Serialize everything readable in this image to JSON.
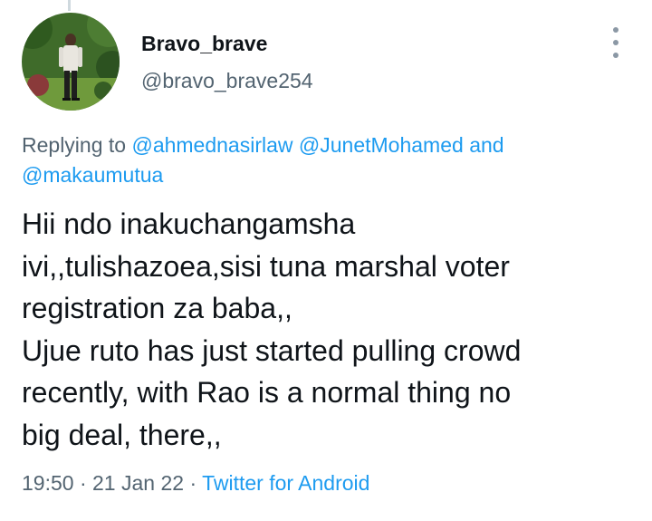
{
  "author": {
    "display_name": "Bravo_brave",
    "handle": "@bravo_brave254"
  },
  "reply": {
    "prefix": "Replying to",
    "mention_1": "@ahmednasirlaw",
    "mention_2": "@JunetMohamed",
    "conjunction": "and",
    "mention_3": "@makaumutua"
  },
  "tweet": {
    "lines": [
      "Hii ndo inakuchangamsha",
      "ivi,,tulishazoea,sisi tuna marshal voter",
      "registration za baba,,",
      "Ujue ruto has just started pulling crowd",
      "recently, with Rao is a normal thing no",
      "big deal, there,,"
    ]
  },
  "meta": {
    "time": "19:50",
    "separator": "·",
    "date": "21 Jan 22",
    "source": "Twitter for Android"
  },
  "icons": {
    "more": "more-vertical-icon"
  },
  "colors": {
    "text_primary": "#0f1419",
    "text_secondary": "#536471",
    "link": "#1d9bf0"
  }
}
